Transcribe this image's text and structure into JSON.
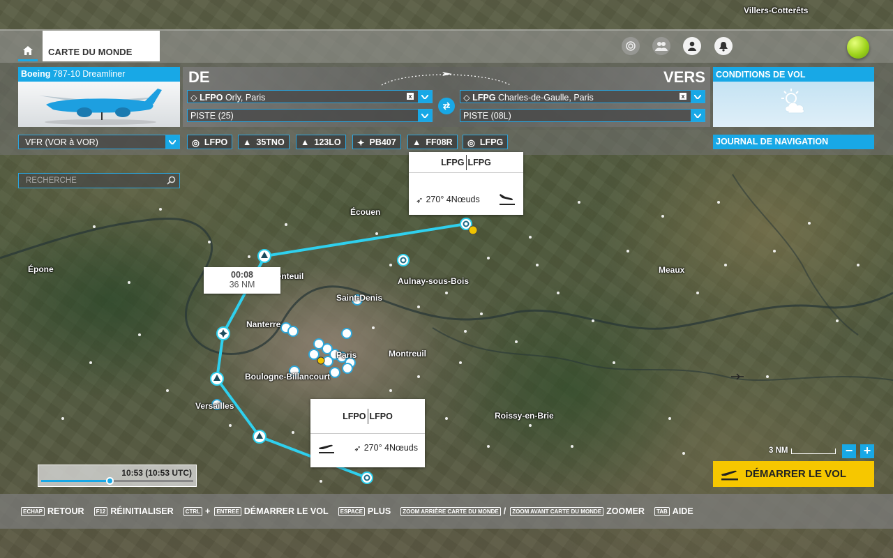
{
  "app": {
    "home_tab_label": "CARTE DU MONDE",
    "status_icons": [
      "target-icon",
      "group-icon",
      "user-icon",
      "bell-icon",
      "ball-icon"
    ]
  },
  "map_labels": {
    "top_city": "Villers-Cotterêts",
    "cities": [
      {
        "name": "Écouen"
      },
      {
        "name": "Épone"
      },
      {
        "name": "Argenteuil"
      },
      {
        "name": "Aulnay-sous-Bois"
      },
      {
        "name": "Saint-Denis"
      },
      {
        "name": "Nanterre"
      },
      {
        "name": "Paris"
      },
      {
        "name": "Montreuil"
      },
      {
        "name": "Boulogne-Billancourt"
      },
      {
        "name": "Versailles"
      },
      {
        "name": "Roissy-en-Brie"
      },
      {
        "name": "Meaux"
      }
    ]
  },
  "aircraft": {
    "brand": "Boeing",
    "model": "787-10 Dreamliner"
  },
  "route": {
    "from_label": "DE",
    "to_label": "VERS",
    "departure": {
      "code": "LFPO",
      "name": "Orly, Paris",
      "clear": "x"
    },
    "departure_runway": "PISTE (25)",
    "arrival": {
      "code": "LFPG",
      "name": "Charles-de-Gaulle, Paris",
      "clear": "x"
    },
    "arrival_runway": "PISTE (08L)"
  },
  "conditions": {
    "title": "CONDITIONS DE VOL",
    "icon": "partly-cloudy-icon"
  },
  "navigation": {
    "flight_type": "VFR (VOR à VOR)",
    "waypoints": [
      {
        "icon": "airport-icon",
        "label": "LFPO"
      },
      {
        "icon": "triangle-icon",
        "label": "35TNO"
      },
      {
        "icon": "triangle-icon",
        "label": "123LO"
      },
      {
        "icon": "vor-icon",
        "label": "PB407"
      },
      {
        "icon": "triangle-icon",
        "label": "FF08R"
      },
      {
        "icon": "airport-icon",
        "label": "LFPG"
      }
    ],
    "log_label": "JOURNAL DE NAVIGATION"
  },
  "search": {
    "placeholder": "RECHERCHE"
  },
  "popups": {
    "arrival": {
      "id_left": "LFPG",
      "id_right": "LFPG",
      "wind": "270° 4Nœuds"
    },
    "departure": {
      "id_left": "LFPO",
      "id_right": "LFPO",
      "wind": "270° 4Nœuds"
    }
  },
  "leg": {
    "time": "00:08",
    "distance": "36 NM"
  },
  "time": {
    "value": "10:53 (10:53 UTC)",
    "progress": 0.45
  },
  "map_controls": {
    "scale_label": "3 NM",
    "zoom_out": "−",
    "zoom_in": "+"
  },
  "start_button": "DÉMARRER LE VOL",
  "bottom_hints": [
    {
      "keys": [
        "ECHAP"
      ],
      "label": "RETOUR"
    },
    {
      "keys": [
        "F12"
      ],
      "label": "RÉINITIALISER"
    },
    {
      "keys": [
        "CTRL",
        "ENTREE"
      ],
      "joiner": "+",
      "label": "DÉMARRER LE VOL"
    },
    {
      "keys": [
        "ESPACE"
      ],
      "label": "PLUS"
    },
    {
      "keys": [
        "ZOOM ARRIÈRE CARTE DU MONDE",
        "ZOOM AVANT CARTE DU MONDE"
      ],
      "joiner": "/",
      "label": "ZOOMER"
    },
    {
      "keys": [
        "TAB"
      ],
      "label": "AIDE"
    }
  ],
  "colors": {
    "accent": "#18a8e6",
    "start_button": "#f6c700",
    "route_line": "#2fd0ee"
  }
}
